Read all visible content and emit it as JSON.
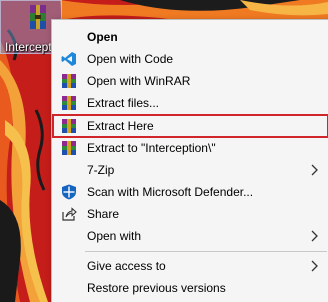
{
  "desktop": {
    "icon_label": "Intercepti"
  },
  "context_menu": {
    "items": [
      {
        "label": "Open",
        "icon": "none",
        "bold": true
      },
      {
        "label": "Open with Code",
        "icon": "vscode-icon"
      },
      {
        "label": "Open with WinRAR",
        "icon": "winrar-icon"
      },
      {
        "label": "Extract files...",
        "icon": "winrar-icon"
      },
      {
        "label": "Extract Here",
        "icon": "winrar-icon",
        "highlighted": true
      },
      {
        "label": "Extract to \"Interception\\\"",
        "icon": "winrar-icon"
      },
      {
        "label": "7-Zip",
        "icon": "none",
        "submenu": true
      },
      {
        "label": "Scan with Microsoft Defender...",
        "icon": "defender-shield-icon"
      },
      {
        "label": "Share",
        "icon": "share-icon"
      },
      {
        "label": "Open with",
        "icon": "none",
        "submenu": true
      },
      {
        "label": "Give access to",
        "icon": "none",
        "submenu": true
      },
      {
        "label": "Restore previous versions",
        "icon": "none"
      }
    ]
  },
  "colors": {
    "highlight_border": "#d0262b",
    "menu_background": "#f5f5f5",
    "wallpaper_red": "#c8201c",
    "wallpaper_orange": "#f07a22"
  }
}
